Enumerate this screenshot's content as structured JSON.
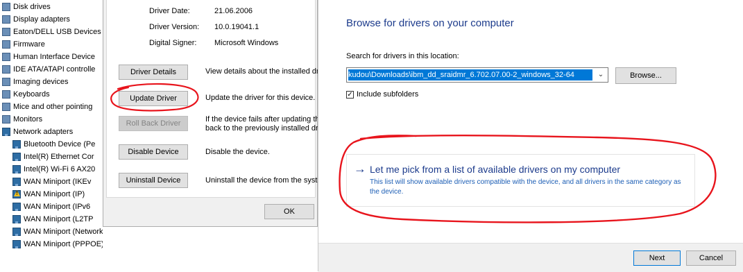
{
  "device_tree": {
    "items": [
      {
        "label": "Disk drives",
        "icon": "disk-drive-icon",
        "kind": "category"
      },
      {
        "label": "Display adapters",
        "icon": "display-adapter-icon",
        "kind": "category"
      },
      {
        "label": "Eaton/DELL USB Devices",
        "icon": "usb-device-icon",
        "kind": "category"
      },
      {
        "label": "Firmware",
        "icon": "firmware-icon",
        "kind": "category"
      },
      {
        "label": "Human Interface Device",
        "icon": "hid-icon",
        "kind": "category"
      },
      {
        "label": "IDE ATA/ATAPI controlle",
        "icon": "ide-controller-icon",
        "kind": "category"
      },
      {
        "label": "Imaging devices",
        "icon": "camera-icon",
        "kind": "category"
      },
      {
        "label": "Keyboards",
        "icon": "keyboard-icon",
        "kind": "category"
      },
      {
        "label": "Mice and other pointing",
        "icon": "mouse-icon",
        "kind": "category"
      },
      {
        "label": "Monitors",
        "icon": "monitor-icon",
        "kind": "category"
      },
      {
        "label": "Network adapters",
        "icon": "network-adapter-icon",
        "kind": "expanded"
      },
      {
        "label": "Bluetooth Device (Pe",
        "icon": "network-adapter-icon",
        "kind": "child"
      },
      {
        "label": "Intel(R) Ethernet Cor",
        "icon": "network-adapter-icon",
        "kind": "child"
      },
      {
        "label": "Intel(R) Wi-Fi 6 AX20",
        "icon": "network-adapter-icon",
        "kind": "child"
      },
      {
        "label": "WAN Miniport (IKEv",
        "icon": "network-adapter-icon",
        "kind": "child"
      },
      {
        "label": "WAN Miniport (IP)",
        "icon": "warning-network-adapter-icon",
        "kind": "child-warning"
      },
      {
        "label": "WAN Miniport (IPv6",
        "icon": "network-adapter-icon",
        "kind": "child"
      },
      {
        "label": "WAN Miniport (L2TP",
        "icon": "network-adapter-icon",
        "kind": "child"
      },
      {
        "label": "WAN Miniport (Network Monitor)",
        "icon": "network-adapter-icon",
        "kind": "child"
      },
      {
        "label": "WAN Miniport (PPPOE)",
        "icon": "network-adapter-icon",
        "kind": "child"
      }
    ]
  },
  "properties": {
    "fields": [
      {
        "label": "Driver Date:",
        "value": "21.06.2006"
      },
      {
        "label": "Driver Version:",
        "value": "10.0.19041.1"
      },
      {
        "label": "Digital Signer:",
        "value": "Microsoft Windows"
      }
    ],
    "actions": [
      {
        "button": "Driver Details",
        "desc": "View details about the installed drive",
        "enabled": true
      },
      {
        "button": "Update Driver",
        "desc": "Update the driver for this device.",
        "enabled": true
      },
      {
        "button": "Roll Back Driver",
        "desc": "If the device fails after updating the\nback to the previously installed drive",
        "enabled": false
      },
      {
        "button": "Disable Device",
        "desc": "Disable the device.",
        "enabled": true
      },
      {
        "button": "Uninstall Device",
        "desc": "Uninstall the device from the system",
        "enabled": true
      }
    ],
    "ok_label": "OK"
  },
  "wizard": {
    "title": "Browse for drivers on your computer",
    "search_label": "Search for drivers in this location:",
    "path_value": "kudou\\Downloads\\ibm_dd_sraidmr_6.702.07.00-2_windows_32-64",
    "browse_label": "Browse...",
    "include_subfolders_label": "Include subfolders",
    "include_subfolders_checked": true,
    "pick_title": "Let me pick from a list of available drivers on my computer",
    "pick_desc": "This list will show available drivers compatible with the device, and all drivers in the same category as the device.",
    "next_label": "Next",
    "cancel_label": "Cancel"
  },
  "colors": {
    "annotation": "#e8141c",
    "link_blue": "#1c3b8c",
    "selection_blue": "#0078d7"
  }
}
